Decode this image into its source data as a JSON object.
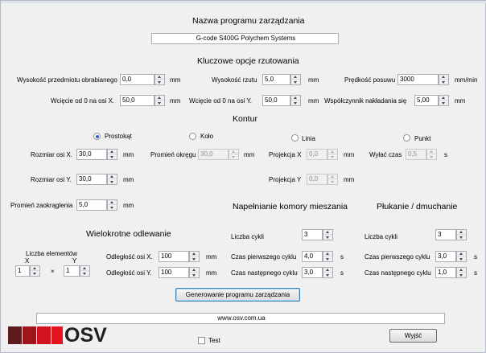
{
  "title": "Nazwa programu zarządzania",
  "program_name": "G-code S400G Polychem Systems",
  "key_options": {
    "heading": "Kluczowe opcje rzutowania",
    "height_label": "Wysokość przedmiotu obrabianego",
    "height_value": "0,0",
    "height_unit": "mm",
    "throw_label": "Wysokość rzutu",
    "throw_value": "5,0",
    "throw_unit": "mm",
    "feed_label": "Prędkość posuwu",
    "feed_value": "3000",
    "feed_unit": "mm/min",
    "cutx_label": "Wcięcie od 0 na osi X.",
    "cutx_value": "50,0",
    "cutx_unit": "mm",
    "cuty_label": "Wcięcie od 0 na osi Y.",
    "cuty_value": "50,0",
    "cuty_unit": "mm",
    "overlap_label": "Współczynnik nakładania się",
    "overlap_value": "5,00",
    "overlap_unit": "mm"
  },
  "contour": {
    "heading": "Kontur",
    "radio_rect": "Prostokąt",
    "radio_circle": "Koło",
    "radio_line": "Linia",
    "radio_point": "Punkt",
    "sizex_label": "Rozmiar osi X.",
    "sizex_value": "30,0",
    "sizex_unit": "mm",
    "circle_label": "Promień okręgu",
    "circle_value": "30,0",
    "circle_unit": "mm",
    "projx_label": "Projekcja X",
    "projx_value": "0,0",
    "projx_unit": "mm",
    "off_label": "Wyłać czas",
    "off_value": "0,5",
    "off_unit": "s",
    "sizey_label": "Rozmiar osi Y.",
    "sizey_value": "30,0",
    "sizey_unit": "mm",
    "projy_label": "Projekcja Y",
    "projy_value": "0,0",
    "projy_unit": "mm",
    "round_label": "Promień zaokrąglenia",
    "round_value": "5,0",
    "round_unit": "mm"
  },
  "multi": {
    "heading": "Wielokrotne odlewanie",
    "count_label": "Liczba elementów",
    "x_label": "X",
    "y_label": "Y",
    "count_x": "1",
    "times": "×",
    "count_y": "1",
    "distx_label": "Odległość osi X.",
    "distx_value": "100",
    "distx_unit": "mm",
    "disty_label": "Odległość osi Y.",
    "disty_value": "100",
    "disty_unit": "mm"
  },
  "fill": {
    "heading": "Napełnianie komory mieszania",
    "cycles_label": "Liczba cykli",
    "cycles_value": "3",
    "first_label": "Czas pierwszego cyklu",
    "first_value": "4,0",
    "first_unit": "s",
    "next_label": "Czas następnego cyklu",
    "next_value": "3,0",
    "next_unit": "s"
  },
  "rinse": {
    "heading": "Płukanie / dmuchanie",
    "cycles_label": "Liczba cykli",
    "cycles_value": "3",
    "first_label": "Czas pierwszego cyklu",
    "first_value": "3,0",
    "first_unit": "s",
    "next_label": "Czas następnego cyklu",
    "next_value": "1,0",
    "next_unit": "s"
  },
  "generate_button": "Generowanie programu zarządzania",
  "website": "www.osv.com.ua",
  "logo_text": "OSV",
  "logo_colors": [
    "#5e1a1d",
    "#a0141b",
    "#d2141e",
    "#e3141e"
  ],
  "test_label": "Test",
  "exit_button": "Wyjść"
}
